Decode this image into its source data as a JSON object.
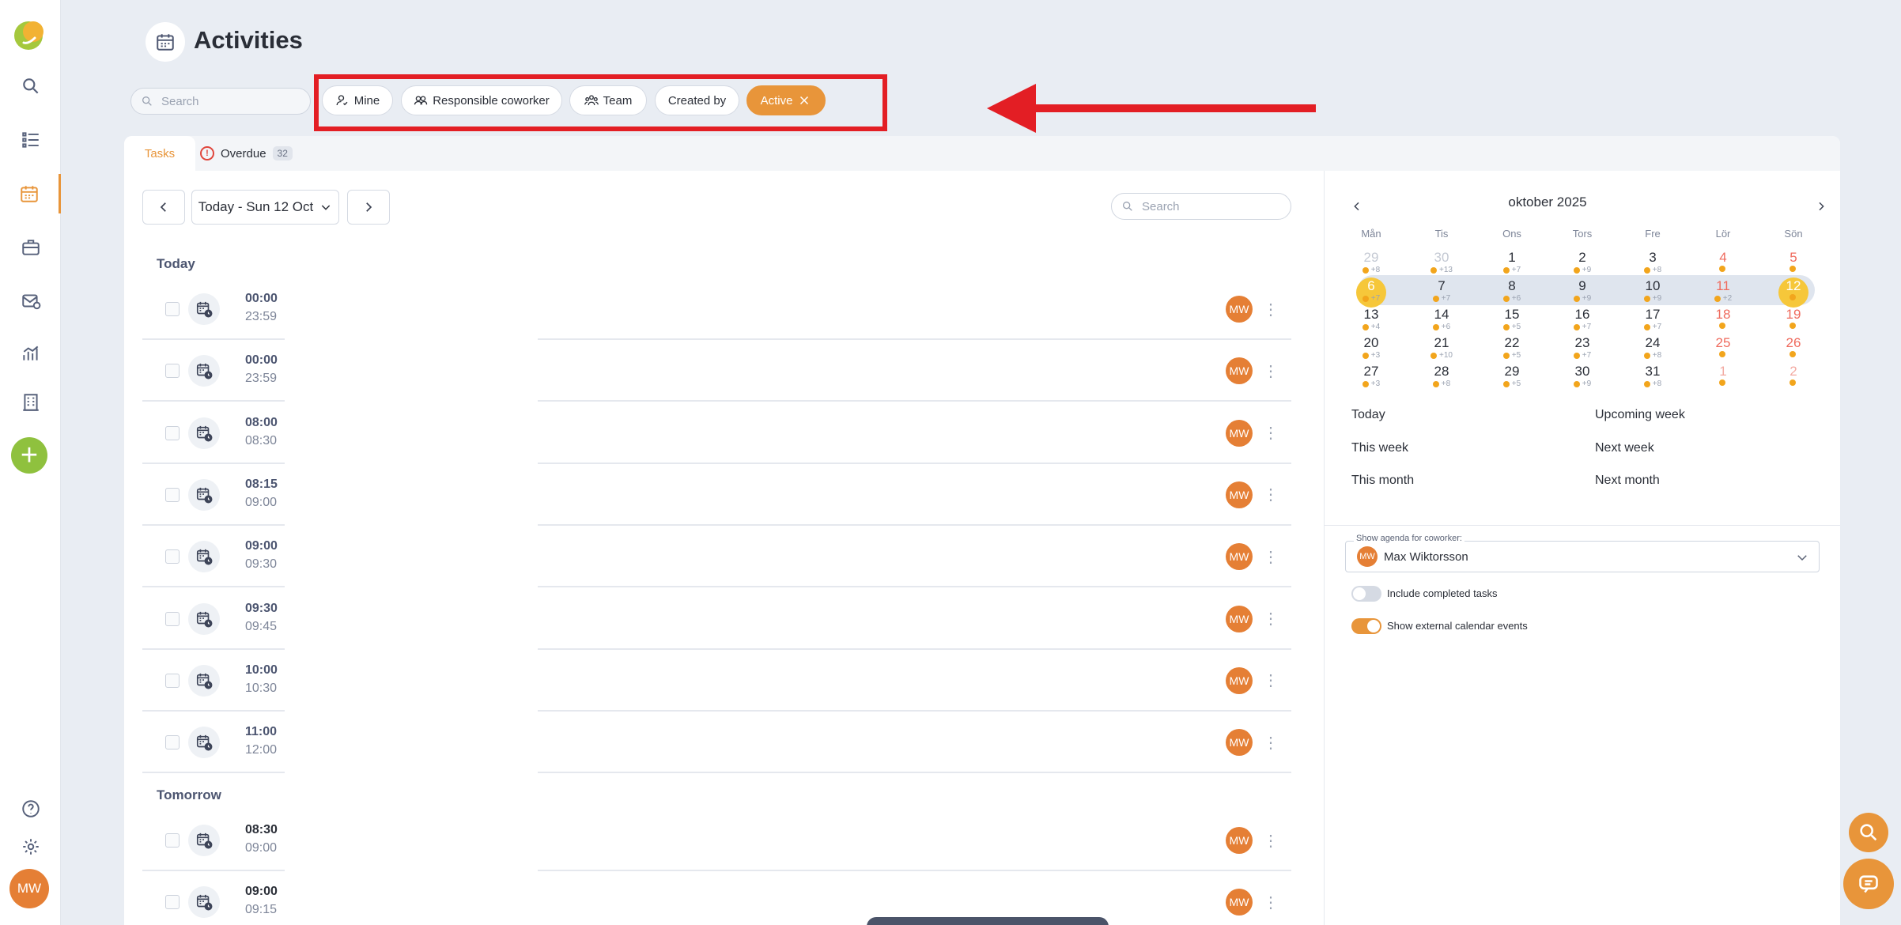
{
  "page": {
    "title": "Activities"
  },
  "search": {
    "placeholder": "Search"
  },
  "filters": [
    {
      "label": "Mine",
      "icon": "user-icon"
    },
    {
      "label": "Responsible coworker",
      "icon": "users-icon"
    },
    {
      "label": "Team",
      "icon": "team-icon"
    },
    {
      "label": "Created by",
      "icon": ""
    },
    {
      "label": "Active",
      "icon": "close-icon",
      "active": true
    }
  ],
  "tabs": {
    "tasks": "Tasks",
    "overdue": "Overdue",
    "overdue_count": "32"
  },
  "date_nav": {
    "label": "Today - Sun 12 Oct"
  },
  "list_search": {
    "placeholder": "Search"
  },
  "groups": {
    "today": {
      "label": "Today",
      "tasks": [
        {
          "start": "00:00",
          "end": "23:59",
          "owner": "MW"
        },
        {
          "start": "00:00",
          "end": "23:59",
          "owner": "MW"
        },
        {
          "start": "08:00",
          "end": "08:30",
          "owner": "MW"
        },
        {
          "start": "08:15",
          "end": "09:00",
          "owner": "MW"
        },
        {
          "start": "09:00",
          "end": "09:30",
          "owner": "MW"
        },
        {
          "start": "09:30",
          "end": "09:45",
          "owner": "MW"
        },
        {
          "start": "10:00",
          "end": "10:30",
          "owner": "MW"
        },
        {
          "start": "11:00",
          "end": "12:00",
          "owner": "MW"
        }
      ]
    },
    "tomorrow": {
      "label": "Tomorrow",
      "tasks": [
        {
          "start": "08:30",
          "end": "09:00",
          "owner": "MW"
        },
        {
          "start": "09:00",
          "end": "09:15",
          "owner": "MW"
        }
      ]
    }
  },
  "calendar": {
    "title": "oktober 2025",
    "weekdays": [
      "Mån",
      "Tis",
      "Ons",
      "Tors",
      "Fre",
      "Lör",
      "Sön"
    ],
    "weeks": [
      [
        {
          "d": "29",
          "s": "+8",
          "m": true
        },
        {
          "d": "30",
          "s": "+13",
          "m": true
        },
        {
          "d": "1",
          "s": "+7"
        },
        {
          "d": "2",
          "s": "+9"
        },
        {
          "d": "3",
          "s": "+8"
        },
        {
          "d": "4",
          "s": ""
        },
        {
          "d": "5",
          "s": ""
        }
      ],
      [
        {
          "d": "6",
          "s": "+7"
        },
        {
          "d": "7",
          "s": "+7"
        },
        {
          "d": "8",
          "s": "+6"
        },
        {
          "d": "9",
          "s": "+9"
        },
        {
          "d": "10",
          "s": "+9"
        },
        {
          "d": "11",
          "s": "+2"
        },
        {
          "d": "12",
          "s": ""
        }
      ],
      [
        {
          "d": "13",
          "s": "+4"
        },
        {
          "d": "14",
          "s": "+6"
        },
        {
          "d": "15",
          "s": "+5"
        },
        {
          "d": "16",
          "s": "+7"
        },
        {
          "d": "17",
          "s": "+7"
        },
        {
          "d": "18",
          "s": ""
        },
        {
          "d": "19",
          "s": ""
        }
      ],
      [
        {
          "d": "20",
          "s": "+3"
        },
        {
          "d": "21",
          "s": "+10"
        },
        {
          "d": "22",
          "s": "+5"
        },
        {
          "d": "23",
          "s": "+7"
        },
        {
          "d": "24",
          "s": "+8"
        },
        {
          "d": "25",
          "s": ""
        },
        {
          "d": "26",
          "s": ""
        }
      ],
      [
        {
          "d": "27",
          "s": "+3"
        },
        {
          "d": "28",
          "s": "+8"
        },
        {
          "d": "29",
          "s": "+5"
        },
        {
          "d": "30",
          "s": "+9"
        },
        {
          "d": "31",
          "s": "+8"
        },
        {
          "d": "1",
          "s": "",
          "m": true
        },
        {
          "d": "2",
          "s": "",
          "m": true
        }
      ]
    ],
    "quick_links": [
      "Today",
      "Upcoming week",
      "This week",
      "Next week",
      "This month",
      "Next month"
    ]
  },
  "agenda": {
    "label": "Show agenda for coworker:",
    "coworker": "Max Wiktorsson",
    "initials": "MW"
  },
  "toggles": {
    "include_completed": {
      "label": "Include completed tasks",
      "on": false
    },
    "external_events": {
      "label": "Show external calendar events",
      "on": true
    }
  },
  "user": {
    "initials": "MW"
  },
  "colors": {
    "accent": "#e8953a",
    "highlight": "#e31e24",
    "add": "#8fc13e",
    "today": "#f6c73a"
  }
}
